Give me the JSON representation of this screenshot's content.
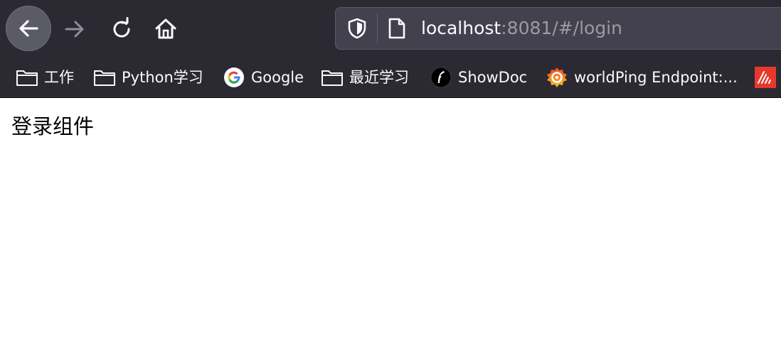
{
  "browser": {
    "url_host": "localhost",
    "url_rest": ":8081/#/login"
  },
  "bookmarks": [
    {
      "label": "工作",
      "icon": "folder-icon"
    },
    {
      "label": "Python学习",
      "icon": "folder-icon"
    },
    {
      "label": "Google",
      "icon": "google-icon"
    },
    {
      "label": "最近学习",
      "icon": "folder-icon"
    },
    {
      "label": "ShowDoc",
      "icon": "showdoc-icon"
    },
    {
      "label": "worldPing Endpoint:...",
      "icon": "grafana-icon"
    },
    {
      "label": "",
      "icon": "red-app-icon"
    }
  ],
  "page": {
    "title": "登录组件"
  },
  "colors": {
    "chrome_bg": "#2b2a33",
    "urlbar_bg": "#42414d",
    "text_light": "#fbfbfe",
    "text_dim": "#9b9ba3"
  }
}
